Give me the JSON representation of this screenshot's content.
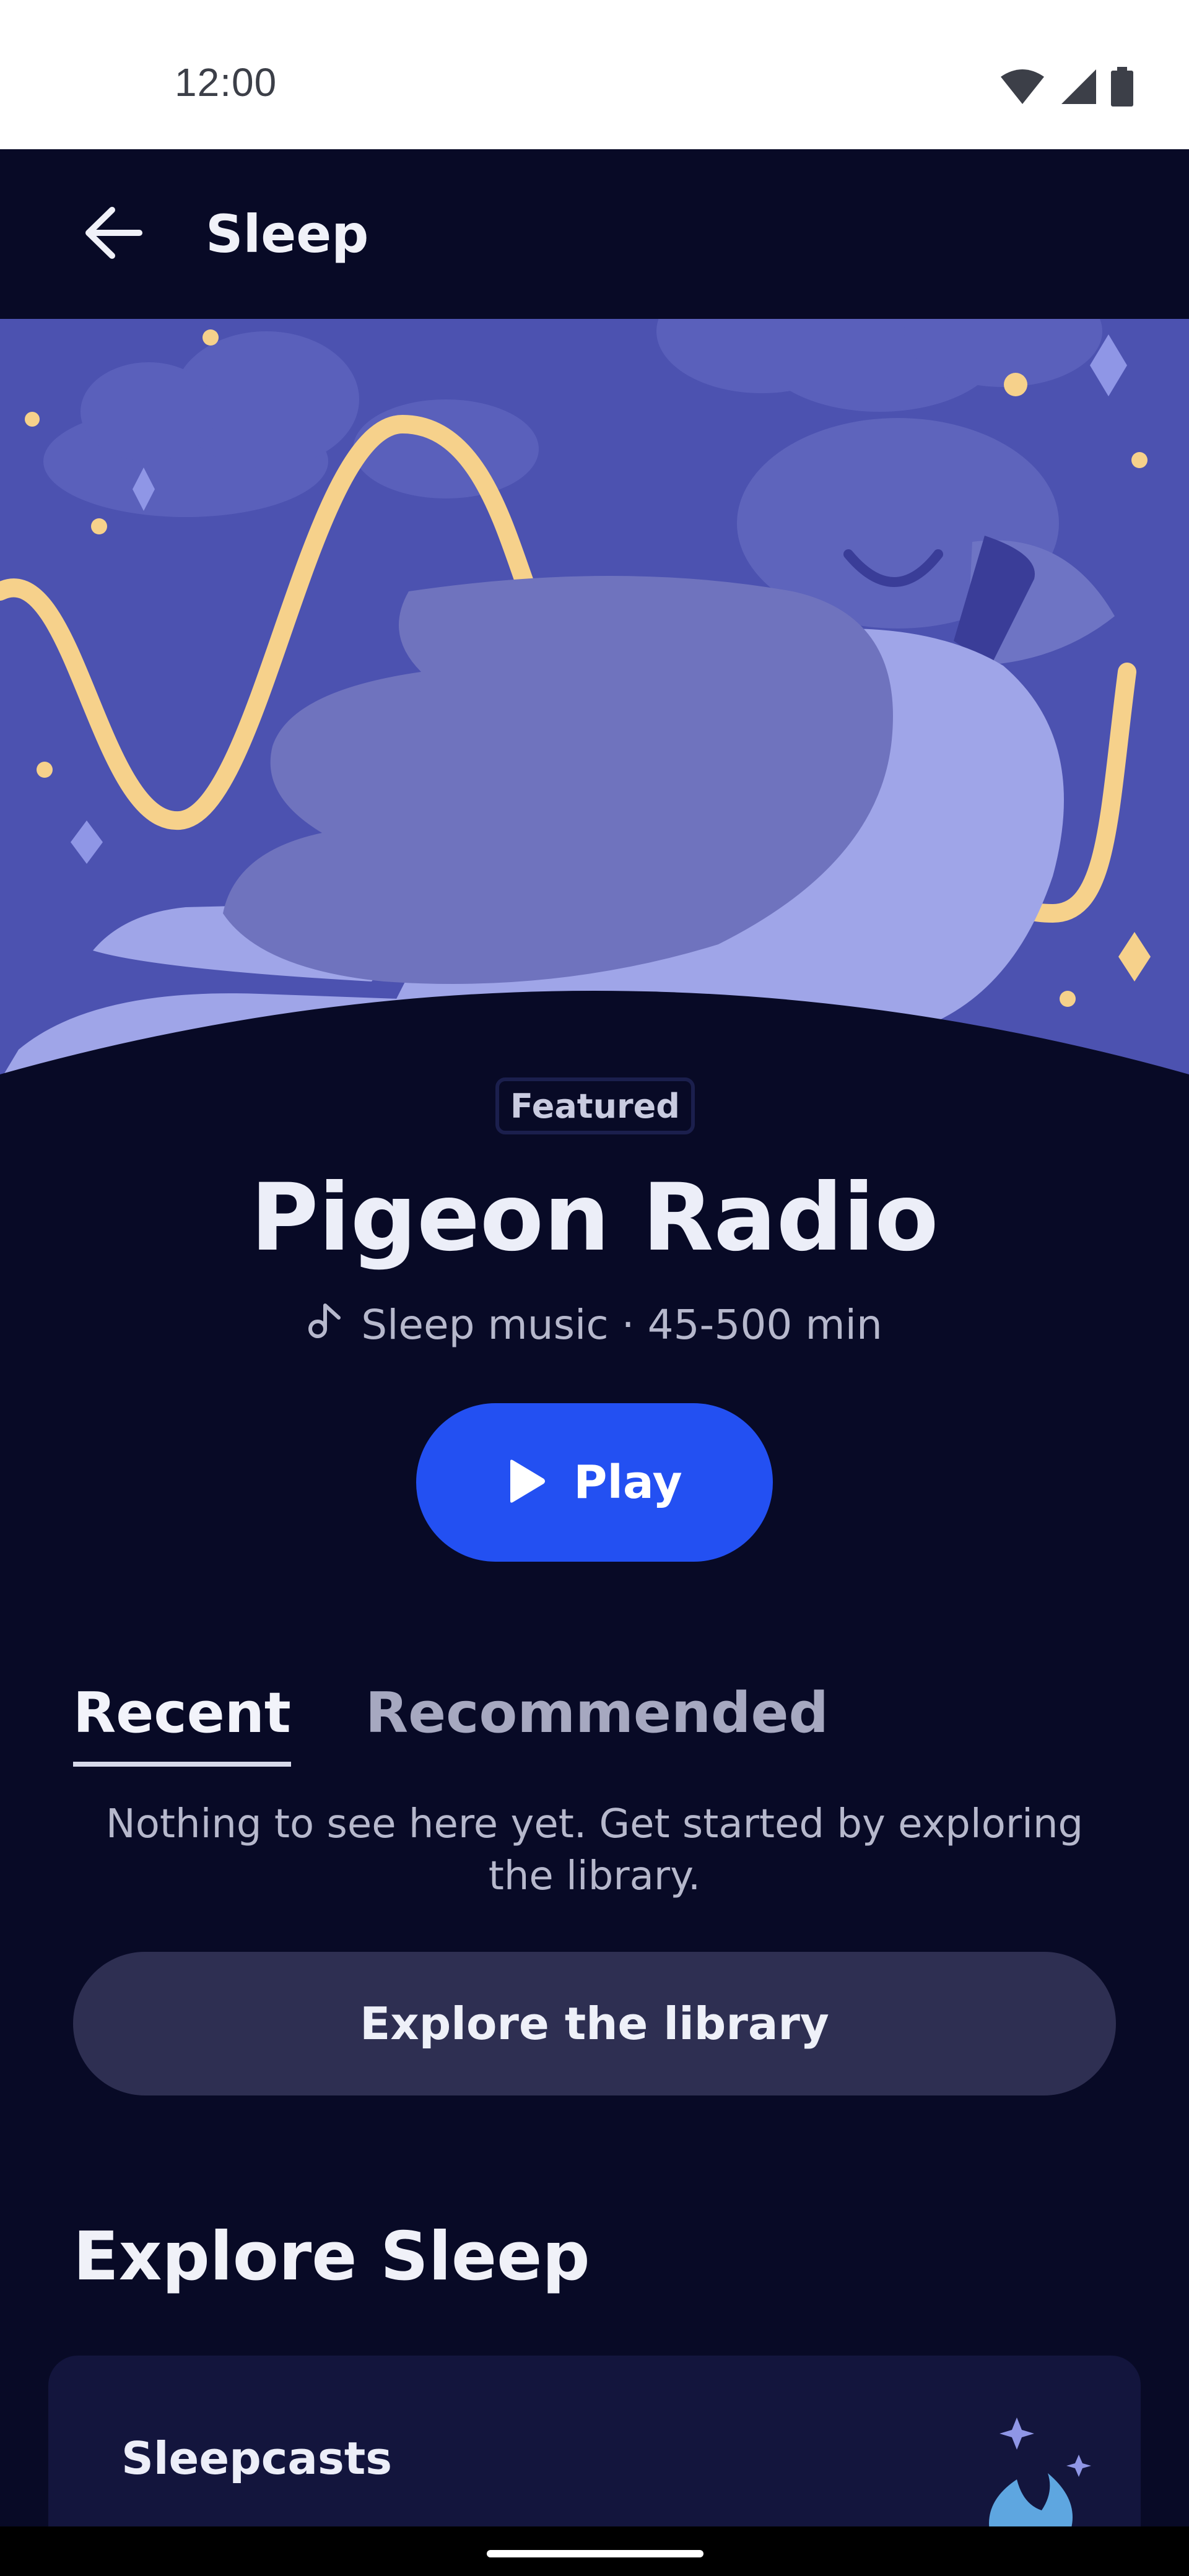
{
  "status_bar": {
    "time": "12:00",
    "icons": [
      "wifi-icon",
      "cellular-signal-icon",
      "battery-icon"
    ]
  },
  "app_bar": {
    "back_icon": "arrow-back-icon",
    "title": "Sleep"
  },
  "hero": {
    "illustration": "sleeping-pigeon-illustration",
    "colors": {
      "sky": "#4c52b0",
      "wave": "#f6d18b",
      "bird_body": "#9fa5e8",
      "bird_wing": "#6f73be"
    }
  },
  "featured": {
    "badge": "Featured",
    "title": "Pigeon Radio",
    "meta_icon": "music-note-icon",
    "meta": "Sleep music · 45-500 min",
    "play_label": "Play",
    "play_icon": "play-icon"
  },
  "tabs": {
    "items": [
      {
        "label": "Recent",
        "active": true
      },
      {
        "label": "Recommended",
        "active": false
      }
    ]
  },
  "empty_state": {
    "message": "Nothing to see here yet. Get started by exploring the library.",
    "button_label": "Explore the library"
  },
  "explore": {
    "section_title": "Explore Sleep",
    "cards": [
      {
        "title": "Sleepcasts"
      }
    ]
  },
  "colors": {
    "background": "#080a26",
    "accent": "#2350f2",
    "secondary_button": "#2e2f52",
    "card": "#13153d"
  }
}
